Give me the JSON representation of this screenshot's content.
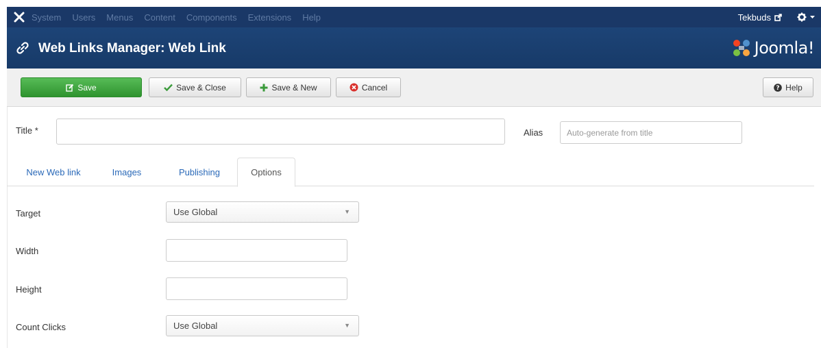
{
  "topnav": {
    "menu": [
      "System",
      "Users",
      "Menus",
      "Content",
      "Components",
      "Extensions",
      "Help"
    ],
    "user": "Tekbuds"
  },
  "header": {
    "title": "Web Links Manager: Web Link",
    "brand": "Joomla!"
  },
  "toolbar": {
    "save": "Save",
    "save_close": "Save & Close",
    "save_new": "Save & New",
    "cancel": "Cancel",
    "help": "Help"
  },
  "form": {
    "title_label": "Title *",
    "title_value": "",
    "alias_label": "Alias",
    "alias_placeholder": "Auto-generate from title"
  },
  "tabs": [
    "New Web link",
    "Images",
    "Publishing",
    "Options"
  ],
  "active_tab": "Options",
  "options": {
    "target_label": "Target",
    "target_value": "Use Global",
    "width_label": "Width",
    "width_value": "",
    "height_label": "Height",
    "height_value": "",
    "count_clicks_label": "Count Clicks",
    "count_clicks_value": "Use Global"
  },
  "colors": {
    "navbar": "#1a3867",
    "header": "#1d4477",
    "save_button": "#3ea33e",
    "tab_link": "#2a69b8"
  }
}
